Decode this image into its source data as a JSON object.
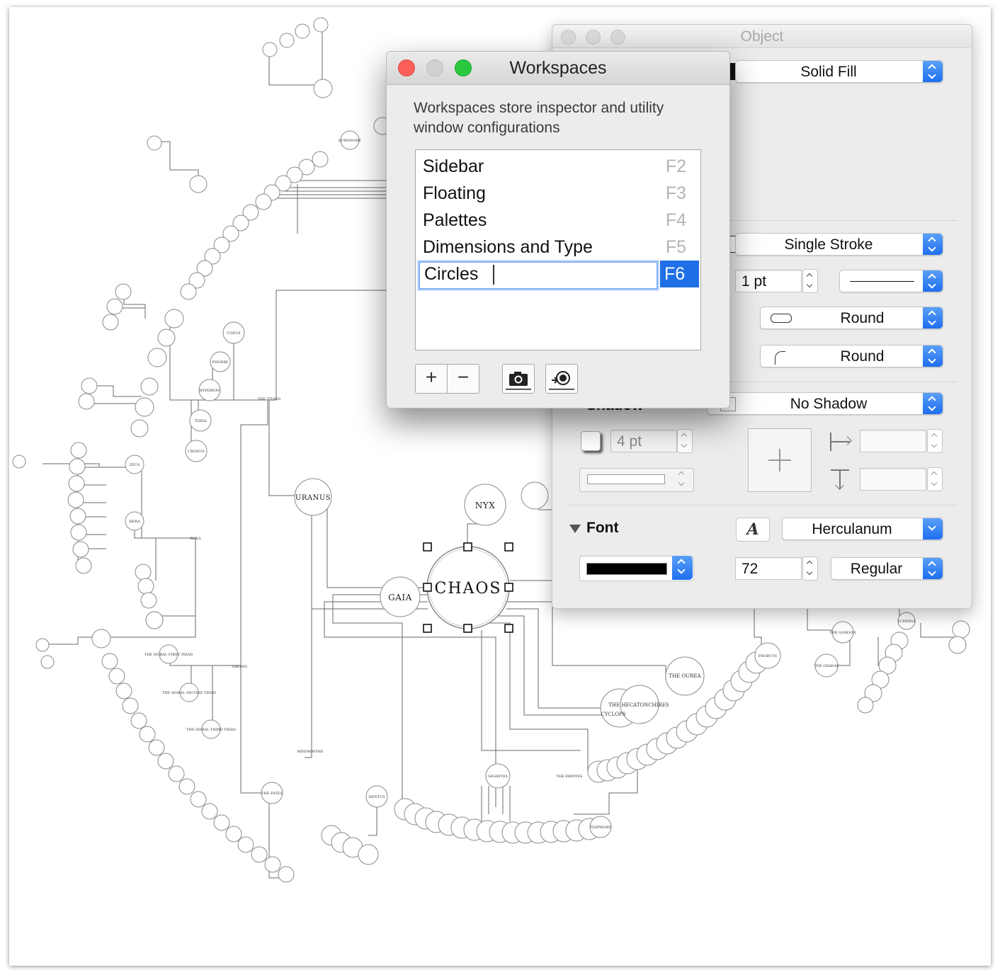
{
  "diagram": {
    "center_node": "CHAOS",
    "primary_nodes": [
      "GAIA",
      "NYX",
      "URANUS",
      "HEMERA"
    ],
    "secondary_nodes": [
      "THE TITANS",
      "THE OUREA",
      "THE HECATONCHIRES",
      "CYCLOPS",
      "GIGANTES",
      "THE ERINYES",
      "PHORCYS",
      "THEMIS",
      "MNEMOSYNE",
      "IAPETUS",
      "THE FATES",
      "COEUS",
      "PHOEBE",
      "HYPERION",
      "THEIA",
      "CRONUS",
      "ZEUS",
      "RHEA",
      "HERA",
      "THE GORGON",
      "THE GRAEAE",
      "TISIPHONE",
      "ECHIDNA",
      "THE HORAI: FIRST TRIAD",
      "THE HORAI: SECOND TRIAD",
      "THE HORAI: THIRD TRIAD"
    ]
  },
  "object_inspector": {
    "title": "Object",
    "fill": {
      "type": "Solid Fill"
    },
    "stroke": {
      "type": "Single Stroke",
      "width": "1 pt",
      "cap": "Round",
      "join": "Round"
    },
    "shadow": {
      "header": "Shadow",
      "type": "No Shadow",
      "blur": "4 pt"
    },
    "font": {
      "header": "Font",
      "family": "Herculanum",
      "size": "72",
      "style": "Regular",
      "color": "#000000"
    }
  },
  "workspaces": {
    "title": "Workspaces",
    "description": "Workspaces store inspector and utility window configurations",
    "items": [
      {
        "name": "Sidebar",
        "key": "F2"
      },
      {
        "name": "Floating",
        "key": "F3"
      },
      {
        "name": "Palettes",
        "key": "F4"
      },
      {
        "name": "Dimensions and Type",
        "key": "F5"
      },
      {
        "name": "Circles",
        "key": "F6"
      }
    ],
    "buttons": {
      "add": "+",
      "remove": "−"
    }
  },
  "colors": {
    "selection_blue": "#1f6fe6",
    "close_red": "#fc5f57",
    "minimize_grey": "#d1d1d1",
    "zoom_green": "#29c83f"
  }
}
